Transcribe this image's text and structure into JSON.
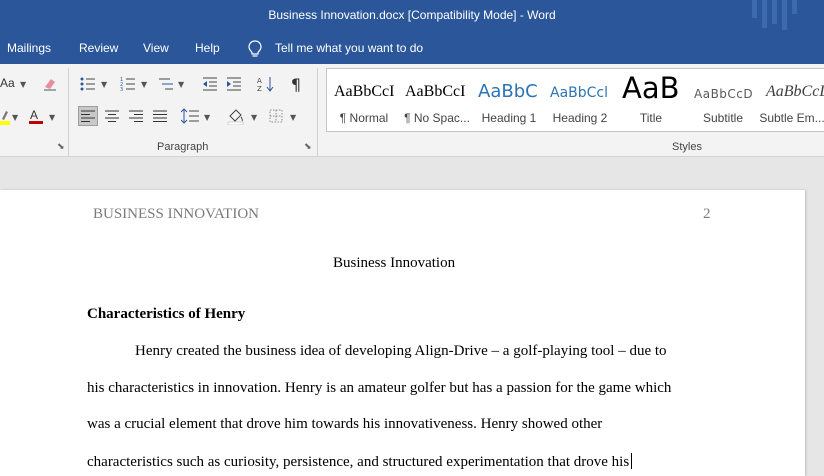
{
  "window": {
    "title": "Business Innovation.docx [Compatibility Mode]  -  Word"
  },
  "menu": {
    "items": [
      "Mailings",
      "Review",
      "View",
      "Help"
    ],
    "tell_me": "Tell me what you want to do"
  },
  "ribbon": {
    "paragraph_label": "Paragraph",
    "styles_label": "Styles",
    "font_partial": "Aa",
    "styles": [
      {
        "sample": "AaBbCcI",
        "label": "¶ Normal"
      },
      {
        "sample": "AaBbCcI",
        "label": "¶ No Spac..."
      },
      {
        "sample": "AaBbC",
        "label": "Heading 1"
      },
      {
        "sample": "AaBbCcl",
        "label": "Heading 2"
      },
      {
        "sample": "AaB",
        "label": "Title"
      },
      {
        "sample": "AaBbCcD",
        "label": "Subtitle"
      },
      {
        "sample": "AaBbCcL",
        "label": "Subtle Em..."
      }
    ],
    "colors": {
      "accent": "#2b579a",
      "font_color": "#c00000",
      "highlight": "#ffff00"
    }
  },
  "document": {
    "running_head": "BUSINESS INNOVATION",
    "page_number": "2",
    "title": "Business Innovation",
    "heading": "Characteristics of Henry",
    "lines": [
      "Henry created the business idea of developing Align-Drive – a golf-playing tool – due to",
      "his characteristics in innovation. Henry is an amateur golfer but has a passion for the game which",
      "was a crucial element that drove him towards his innovativeness. Henry showed other",
      "characteristics such as curiosity, persistence, and structured experimentation that drove his"
    ]
  }
}
